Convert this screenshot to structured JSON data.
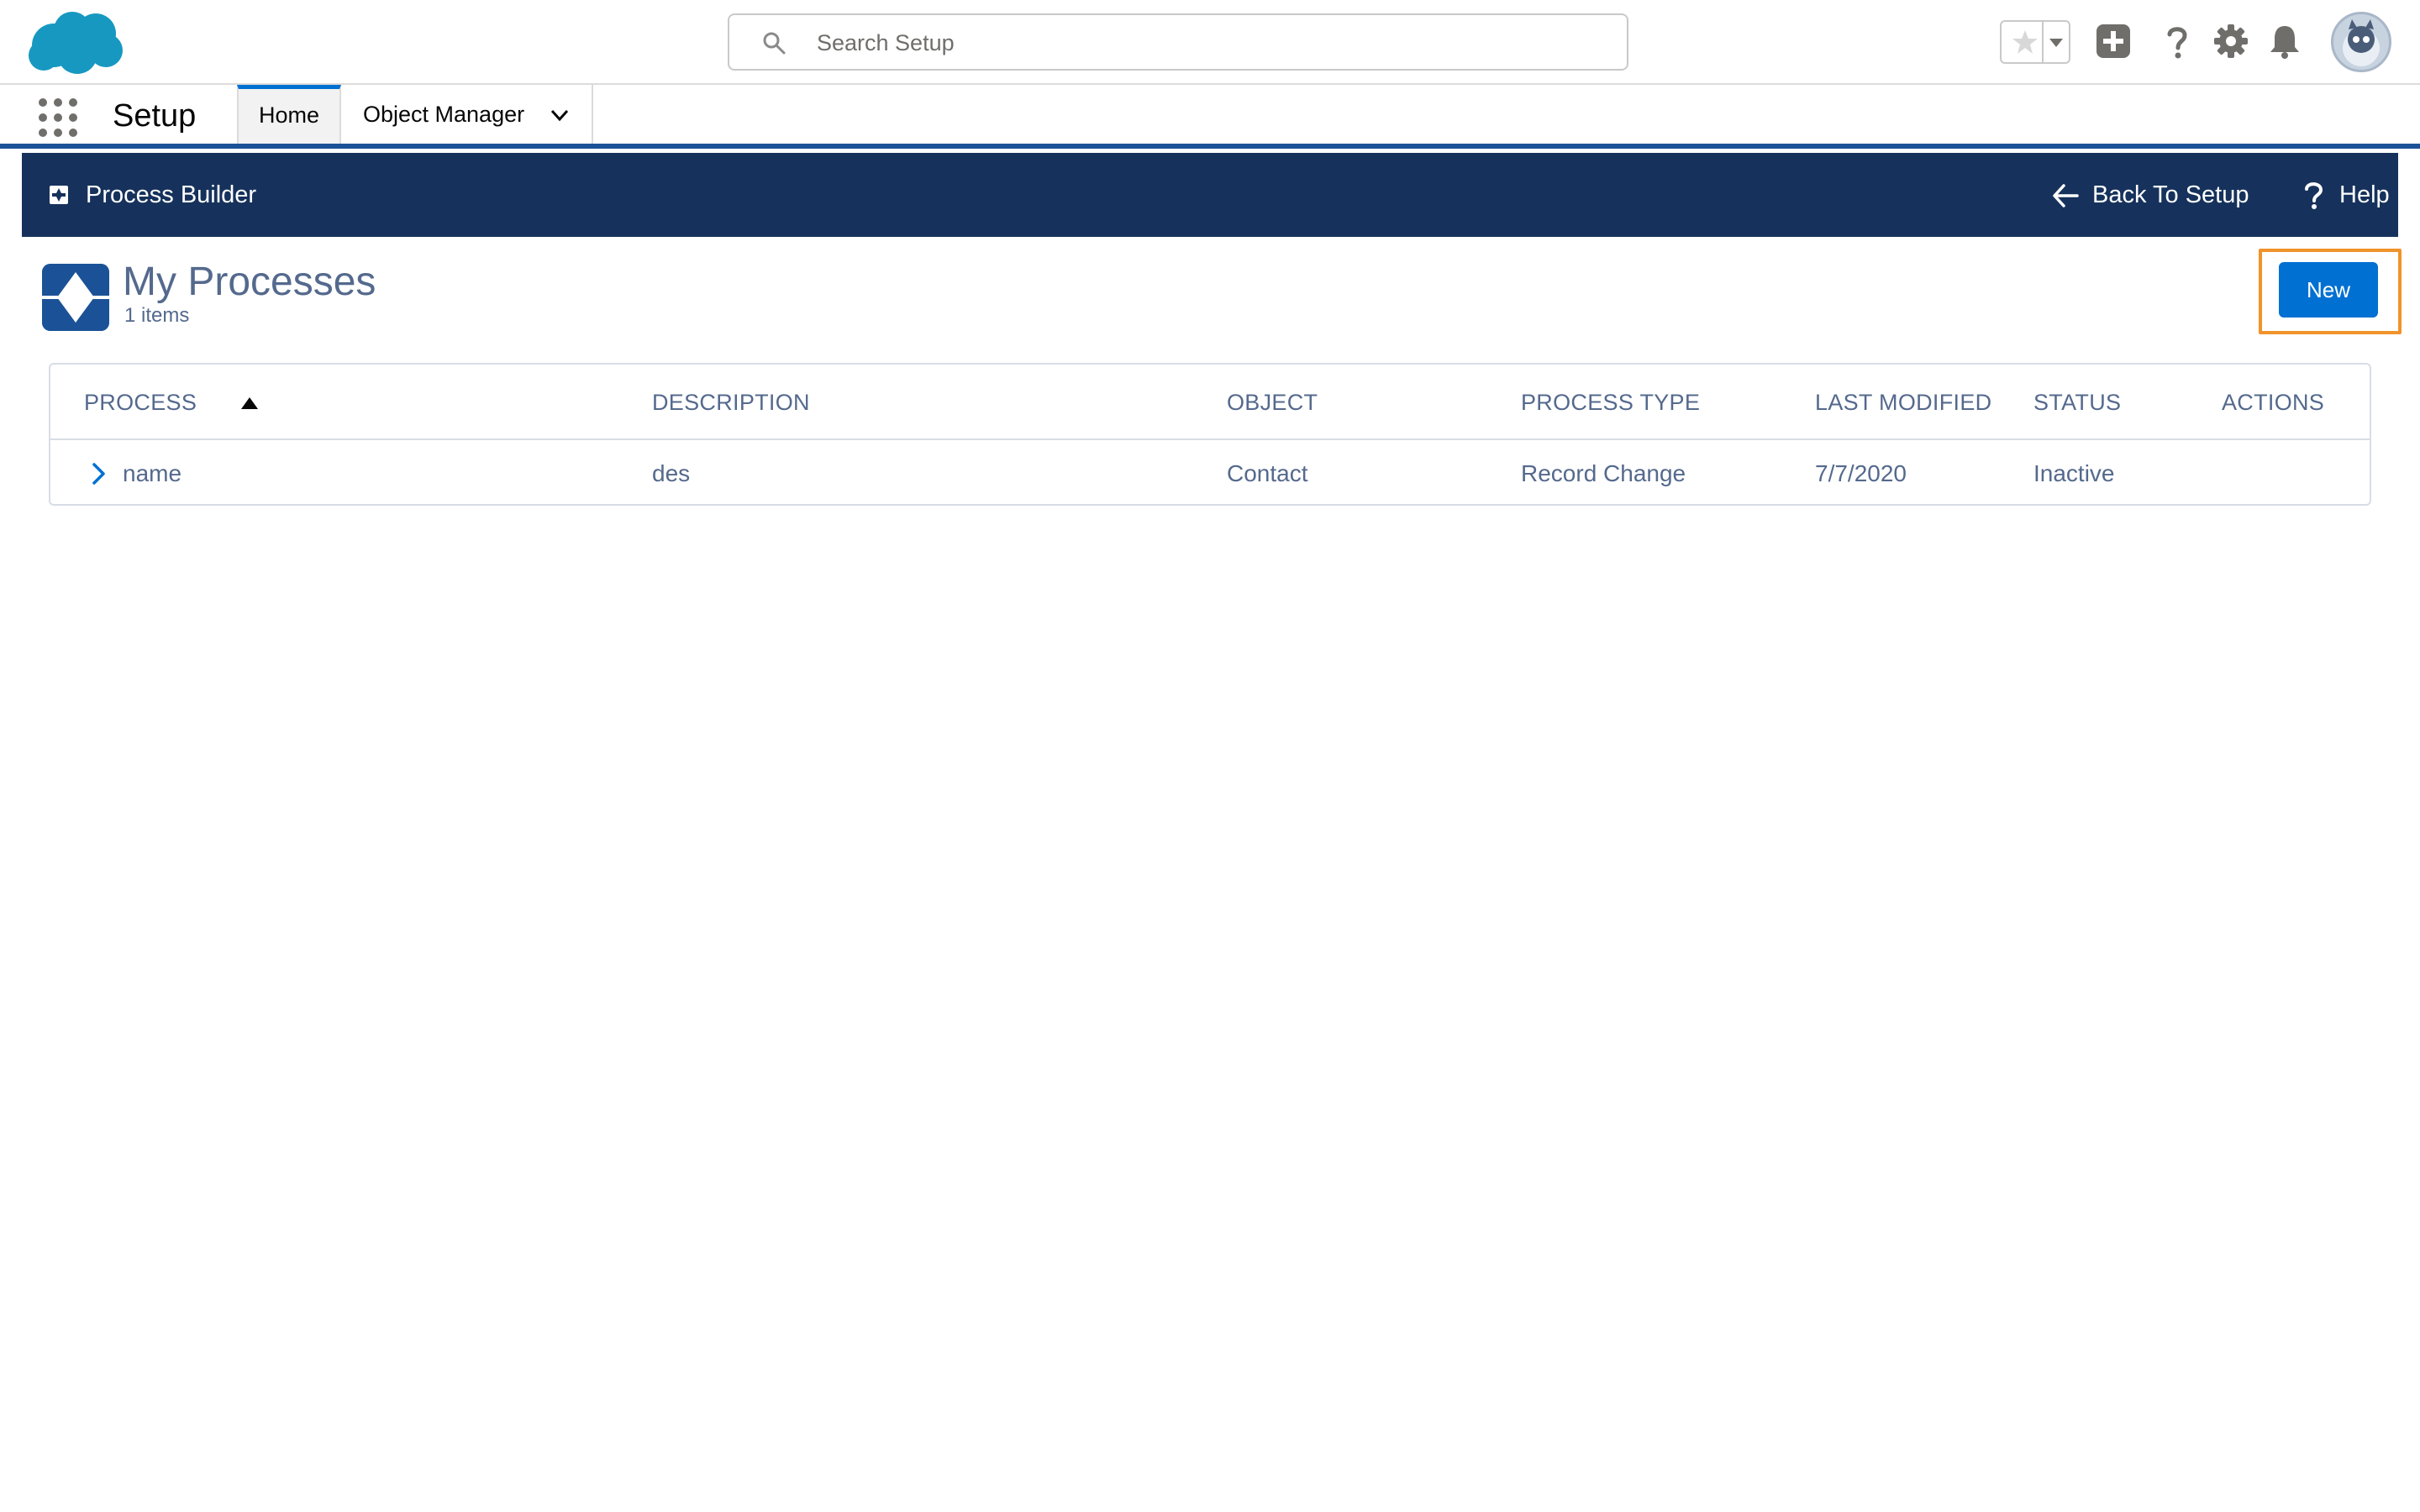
{
  "header": {
    "search_placeholder": "Search Setup",
    "icons": [
      "salesforce-logo",
      "search-icon",
      "star-icon",
      "chevron-down-icon",
      "add-icon",
      "help-icon",
      "gear-icon",
      "bell-icon",
      "avatar"
    ]
  },
  "context_bar": {
    "app_name": "Setup",
    "tabs": [
      {
        "label": "Home",
        "active": true
      },
      {
        "label": "Object Manager",
        "active": false
      }
    ]
  },
  "process_builder_bar": {
    "title": "Process Builder",
    "back_label": "Back To Setup",
    "help_label": "Help"
  },
  "page": {
    "title": "My Processes",
    "item_count": "1 items",
    "new_button": "New"
  },
  "table": {
    "columns": [
      "PROCESS",
      "DESCRIPTION",
      "OBJECT",
      "PROCESS TYPE",
      "LAST MODIFIED",
      "STATUS",
      "ACTIONS"
    ],
    "rows": [
      {
        "process": "name",
        "description": "des",
        "object": "Contact",
        "process_type": "Record Change",
        "last_modified": "7/7/2020",
        "status": "Inactive",
        "actions": ""
      }
    ]
  },
  "colors": {
    "brand_blue": "#0070d2",
    "nav_bar": "#16325c",
    "highlight": "#f0932b",
    "text_muted": "#54698d"
  }
}
